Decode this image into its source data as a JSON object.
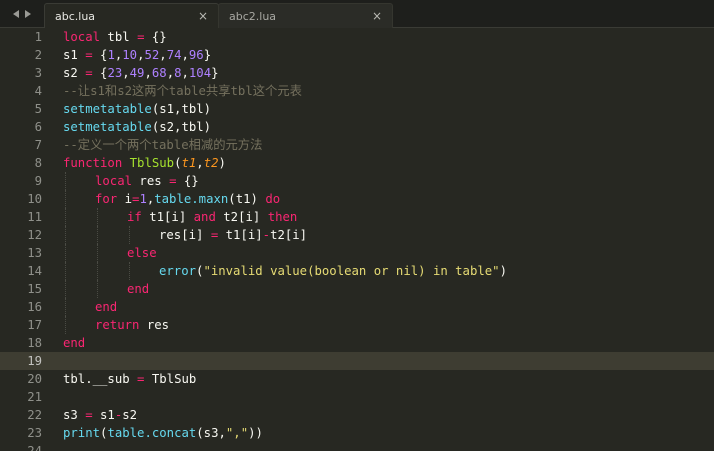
{
  "tabs": [
    {
      "label": "abc.lua",
      "close": "×",
      "active": true
    },
    {
      "label": "abc2.lua",
      "close": "×",
      "active": false
    }
  ],
  "colors": {
    "background": "#272822",
    "keyword": "#f92672",
    "number": "#ae81ff",
    "comment": "#75715e",
    "builtin": "#66d9ef",
    "function_name": "#a6e22e",
    "parameter": "#fd971f",
    "string": "#e6db74",
    "plain": "#f8f8f2"
  },
  "editor": {
    "current_line": 19,
    "lines": [
      {
        "n": "1",
        "indent": 0,
        "tokens": [
          [
            "keyword",
            "local"
          ],
          [
            "plain",
            " tbl "
          ],
          [
            "operator",
            "="
          ],
          [
            "plain",
            " {}"
          ]
        ]
      },
      {
        "n": "2",
        "indent": 0,
        "tokens": [
          [
            "plain",
            "s1 "
          ],
          [
            "operator",
            "="
          ],
          [
            "plain",
            " {"
          ],
          [
            "number",
            "1"
          ],
          [
            "plain",
            ","
          ],
          [
            "number",
            "10"
          ],
          [
            "plain",
            ","
          ],
          [
            "number",
            "52"
          ],
          [
            "plain",
            ","
          ],
          [
            "number",
            "74"
          ],
          [
            "plain",
            ","
          ],
          [
            "number",
            "96"
          ],
          [
            "plain",
            "}"
          ]
        ]
      },
      {
        "n": "3",
        "indent": 0,
        "tokens": [
          [
            "plain",
            "s2 "
          ],
          [
            "operator",
            "="
          ],
          [
            "plain",
            " {"
          ],
          [
            "number",
            "23"
          ],
          [
            "plain",
            ","
          ],
          [
            "number",
            "49"
          ],
          [
            "plain",
            ","
          ],
          [
            "number",
            "68"
          ],
          [
            "plain",
            ","
          ],
          [
            "number",
            "8"
          ],
          [
            "plain",
            ","
          ],
          [
            "number",
            "104"
          ],
          [
            "plain",
            "}"
          ]
        ]
      },
      {
        "n": "4",
        "indent": 0,
        "tokens": [
          [
            "comment",
            "--让s1和s2这两个table共享tbl这个元表"
          ]
        ]
      },
      {
        "n": "5",
        "indent": 0,
        "tokens": [
          [
            "builtin",
            "setmetatable"
          ],
          [
            "plain",
            "(s1,tbl)"
          ]
        ]
      },
      {
        "n": "6",
        "indent": 0,
        "tokens": [
          [
            "builtin",
            "setmetatable"
          ],
          [
            "plain",
            "(s2,tbl)"
          ]
        ]
      },
      {
        "n": "7",
        "indent": 0,
        "tokens": [
          [
            "comment",
            "--定义一个两个table相减的元方法"
          ]
        ]
      },
      {
        "n": "8",
        "indent": 0,
        "tokens": [
          [
            "keyword",
            "function"
          ],
          [
            "plain",
            " "
          ],
          [
            "funcname",
            "TblSub"
          ],
          [
            "plain",
            "("
          ],
          [
            "param",
            "t1"
          ],
          [
            "plain",
            ","
          ],
          [
            "param",
            "t2"
          ],
          [
            "plain",
            ")"
          ]
        ]
      },
      {
        "n": "9",
        "indent": 1,
        "tokens": [
          [
            "keyword",
            "local"
          ],
          [
            "plain",
            " res "
          ],
          [
            "operator",
            "="
          ],
          [
            "plain",
            " {}"
          ]
        ]
      },
      {
        "n": "10",
        "indent": 1,
        "tokens": [
          [
            "keyword",
            "for"
          ],
          [
            "plain",
            " i"
          ],
          [
            "operator",
            "="
          ],
          [
            "number",
            "1"
          ],
          [
            "plain",
            ","
          ],
          [
            "builtin",
            "table.maxn"
          ],
          [
            "plain",
            "(t1) "
          ],
          [
            "keyword",
            "do"
          ]
        ]
      },
      {
        "n": "11",
        "indent": 2,
        "tokens": [
          [
            "keyword",
            "if"
          ],
          [
            "plain",
            " t1[i] "
          ],
          [
            "keyword",
            "and"
          ],
          [
            "plain",
            " t2[i] "
          ],
          [
            "keyword",
            "then"
          ]
        ]
      },
      {
        "n": "12",
        "indent": 3,
        "tokens": [
          [
            "plain",
            "res[i] "
          ],
          [
            "operator",
            "="
          ],
          [
            "plain",
            " t1[i]"
          ],
          [
            "operator",
            "-"
          ],
          [
            "plain",
            "t2[i]"
          ]
        ]
      },
      {
        "n": "13",
        "indent": 2,
        "tokens": [
          [
            "keyword",
            "else"
          ]
        ]
      },
      {
        "n": "14",
        "indent": 3,
        "tokens": [
          [
            "builtin",
            "error"
          ],
          [
            "plain",
            "("
          ],
          [
            "string",
            "\"invalid value(boolean or nil) in table\""
          ],
          [
            "plain",
            ")"
          ]
        ]
      },
      {
        "n": "15",
        "indent": 2,
        "tokens": [
          [
            "keyword",
            "end"
          ]
        ]
      },
      {
        "n": "16",
        "indent": 1,
        "tokens": [
          [
            "keyword",
            "end"
          ]
        ]
      },
      {
        "n": "17",
        "indent": 1,
        "tokens": [
          [
            "keyword",
            "return"
          ],
          [
            "plain",
            " res"
          ]
        ]
      },
      {
        "n": "18",
        "indent": 0,
        "tokens": [
          [
            "keyword",
            "end"
          ]
        ]
      },
      {
        "n": "19",
        "indent": 0,
        "tokens": []
      },
      {
        "n": "20",
        "indent": 0,
        "tokens": [
          [
            "plain",
            "tbl.__sub "
          ],
          [
            "operator",
            "="
          ],
          [
            "plain",
            " TblSub"
          ]
        ]
      },
      {
        "n": "21",
        "indent": 0,
        "tokens": []
      },
      {
        "n": "22",
        "indent": 0,
        "tokens": [
          [
            "plain",
            "s3 "
          ],
          [
            "operator",
            "="
          ],
          [
            "plain",
            " s1"
          ],
          [
            "operator",
            "-"
          ],
          [
            "plain",
            "s2"
          ]
        ]
      },
      {
        "n": "23",
        "indent": 0,
        "tokens": [
          [
            "builtin",
            "print"
          ],
          [
            "plain",
            "("
          ],
          [
            "builtin",
            "table.concat"
          ],
          [
            "plain",
            "(s3,"
          ],
          [
            "string",
            "\",\""
          ],
          [
            "plain",
            "))"
          ]
        ]
      },
      {
        "n": "24",
        "indent": 0,
        "tokens": []
      }
    ]
  }
}
